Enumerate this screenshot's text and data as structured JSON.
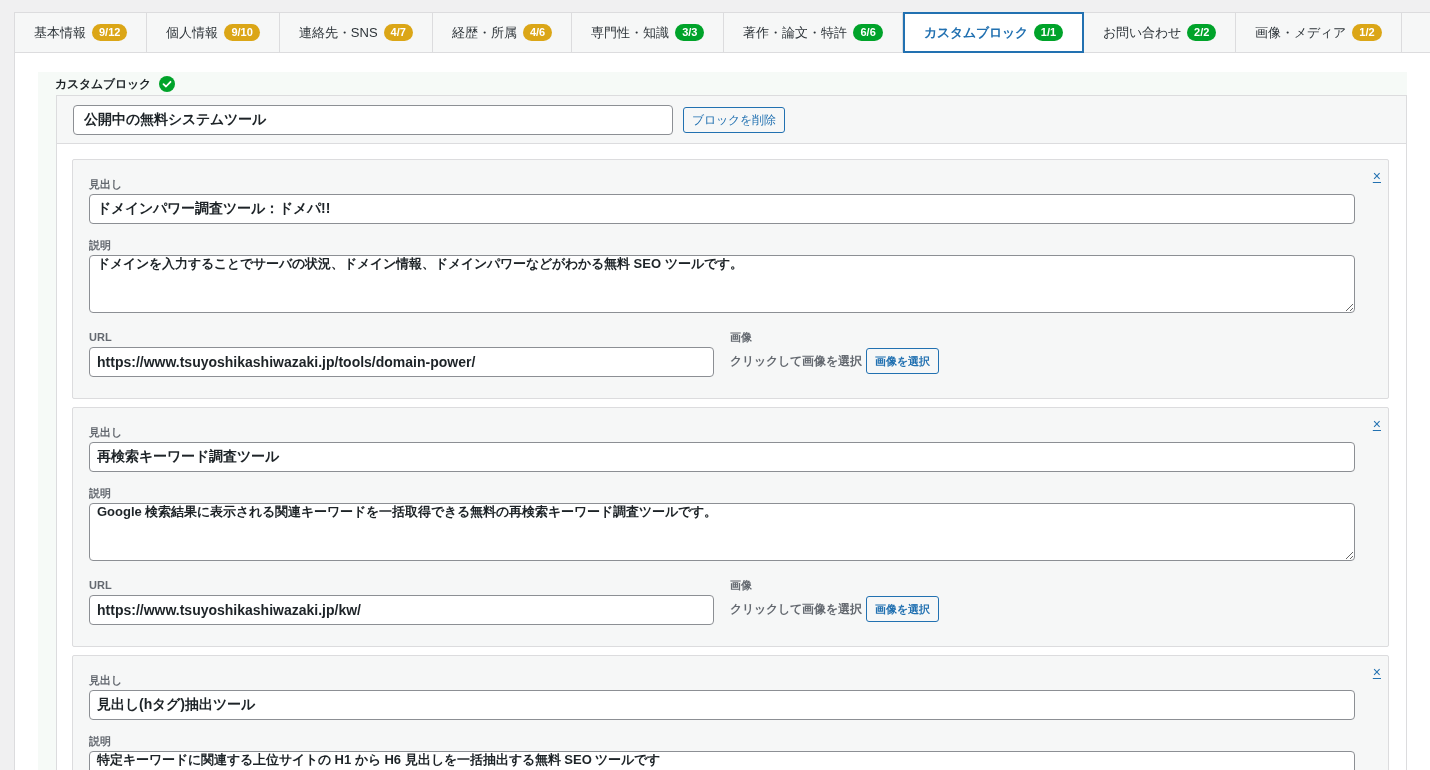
{
  "tabs": [
    {
      "label": "基本情報",
      "count": "9/12",
      "complete": false,
      "selected": false
    },
    {
      "label": "個人情報",
      "count": "9/10",
      "complete": false,
      "selected": false
    },
    {
      "label": "連絡先・SNS",
      "count": "4/7",
      "complete": false,
      "selected": false
    },
    {
      "label": "経歴・所属",
      "count": "4/6",
      "complete": false,
      "selected": false
    },
    {
      "label": "専門性・知識",
      "count": "3/3",
      "complete": true,
      "selected": false
    },
    {
      "label": "著作・論文・特許",
      "count": "6/6",
      "complete": true,
      "selected": false
    },
    {
      "label": "カスタムブロック",
      "count": "1/1",
      "complete": true,
      "selected": true
    },
    {
      "label": "お問い合わせ",
      "count": "2/2",
      "complete": true,
      "selected": false
    },
    {
      "label": "画像・メディア",
      "count": "1/2",
      "complete": false,
      "selected": false
    }
  ],
  "section": {
    "title": "カスタムブロック",
    "complete": true,
    "block": {
      "name": "公開中の無料システムツール",
      "delete_button": "ブロックを削除",
      "items": [
        {
          "remove": "×",
          "heading_label": "見出し",
          "heading": "ドメインパワー調査ツール：ドメパ!!",
          "description_label": "説明",
          "description": "ドメインを入力することでサーバの状況、ドメイン情報、ドメインパワーなどがわかる無料 SEO ツールです。",
          "url_label": "URL",
          "url": "https://www.tsuyoshikashiwazaki.jp/tools/domain-power/",
          "image_label": "画像",
          "image_hint": "クリックして画像を選択",
          "image_button": "画像を選択"
        },
        {
          "remove": "×",
          "heading_label": "見出し",
          "heading": "再検索キーワード調査ツール",
          "description_label": "説明",
          "description": "Google 検索結果に表示される関連キーワードを一括取得できる無料の再検索キーワード調査ツールです。",
          "url_label": "URL",
          "url": "https://www.tsuyoshikashiwazaki.jp/kw/",
          "image_label": "画像",
          "image_hint": "クリックして画像を選択",
          "image_button": "画像を選択"
        },
        {
          "remove": "×",
          "heading_label": "見出し",
          "heading": "見出し(hタグ)抽出ツール",
          "description_label": "説明",
          "description": "特定キーワードに関連する上位サイトの H1 から H6 見出しを一括抽出する無料 SEO ツールです"
        }
      ]
    }
  }
}
